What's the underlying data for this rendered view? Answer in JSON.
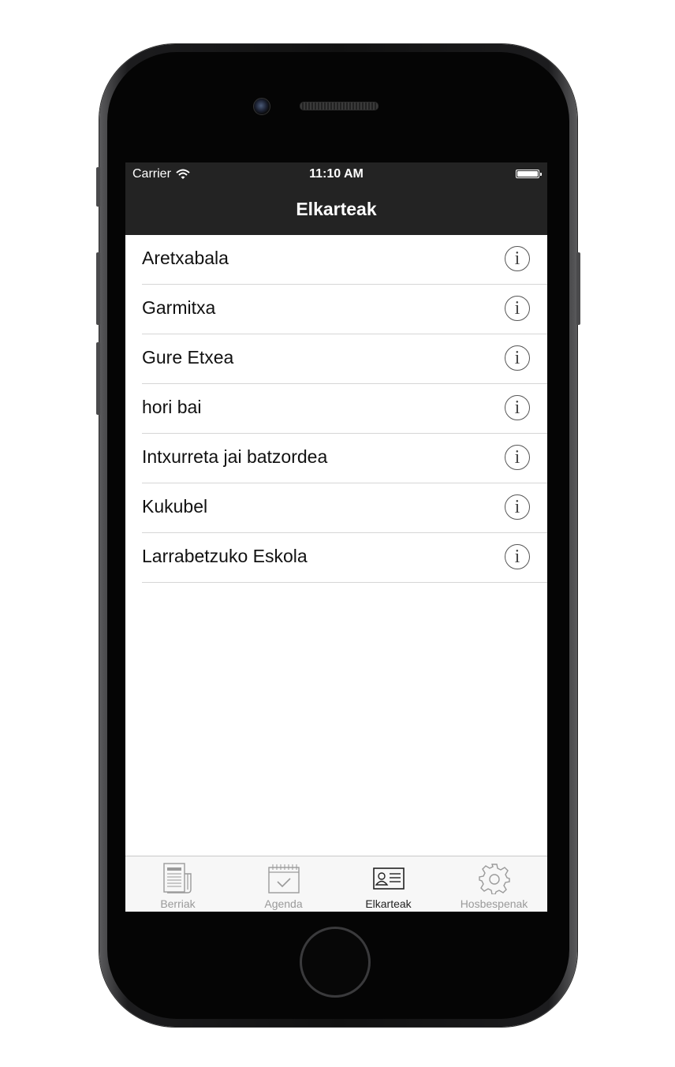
{
  "status_bar": {
    "carrier": "Carrier",
    "time": "11:10 AM"
  },
  "nav": {
    "title": "Elkarteak"
  },
  "list": {
    "items": [
      {
        "label": "Aretxabala",
        "icon": "info-icon"
      },
      {
        "label": "Garmitxa",
        "icon": "info-icon"
      },
      {
        "label": "Gure Etxea",
        "icon": "info-icon"
      },
      {
        "label": "hori bai",
        "icon": "info-icon"
      },
      {
        "label": "Intxurreta jai batzordea",
        "icon": "info-icon"
      },
      {
        "label": "Kukubel",
        "icon": "info-icon"
      },
      {
        "label": "Larrabetzuko Eskola",
        "icon": "info-icon"
      }
    ]
  },
  "tab_bar": {
    "tabs": [
      {
        "label": "Berriak",
        "icon": "newspaper-icon",
        "active": false
      },
      {
        "label": "Agenda",
        "icon": "calendar-icon",
        "active": false
      },
      {
        "label": "Elkarteak",
        "icon": "contact-card-icon",
        "active": true
      },
      {
        "label": "Hosbespenak",
        "icon": "gear-icon",
        "active": false
      }
    ]
  },
  "colors": {
    "bar_background": "#232323",
    "active_tab": "#222222",
    "inactive_tab": "#9a9a9a"
  }
}
